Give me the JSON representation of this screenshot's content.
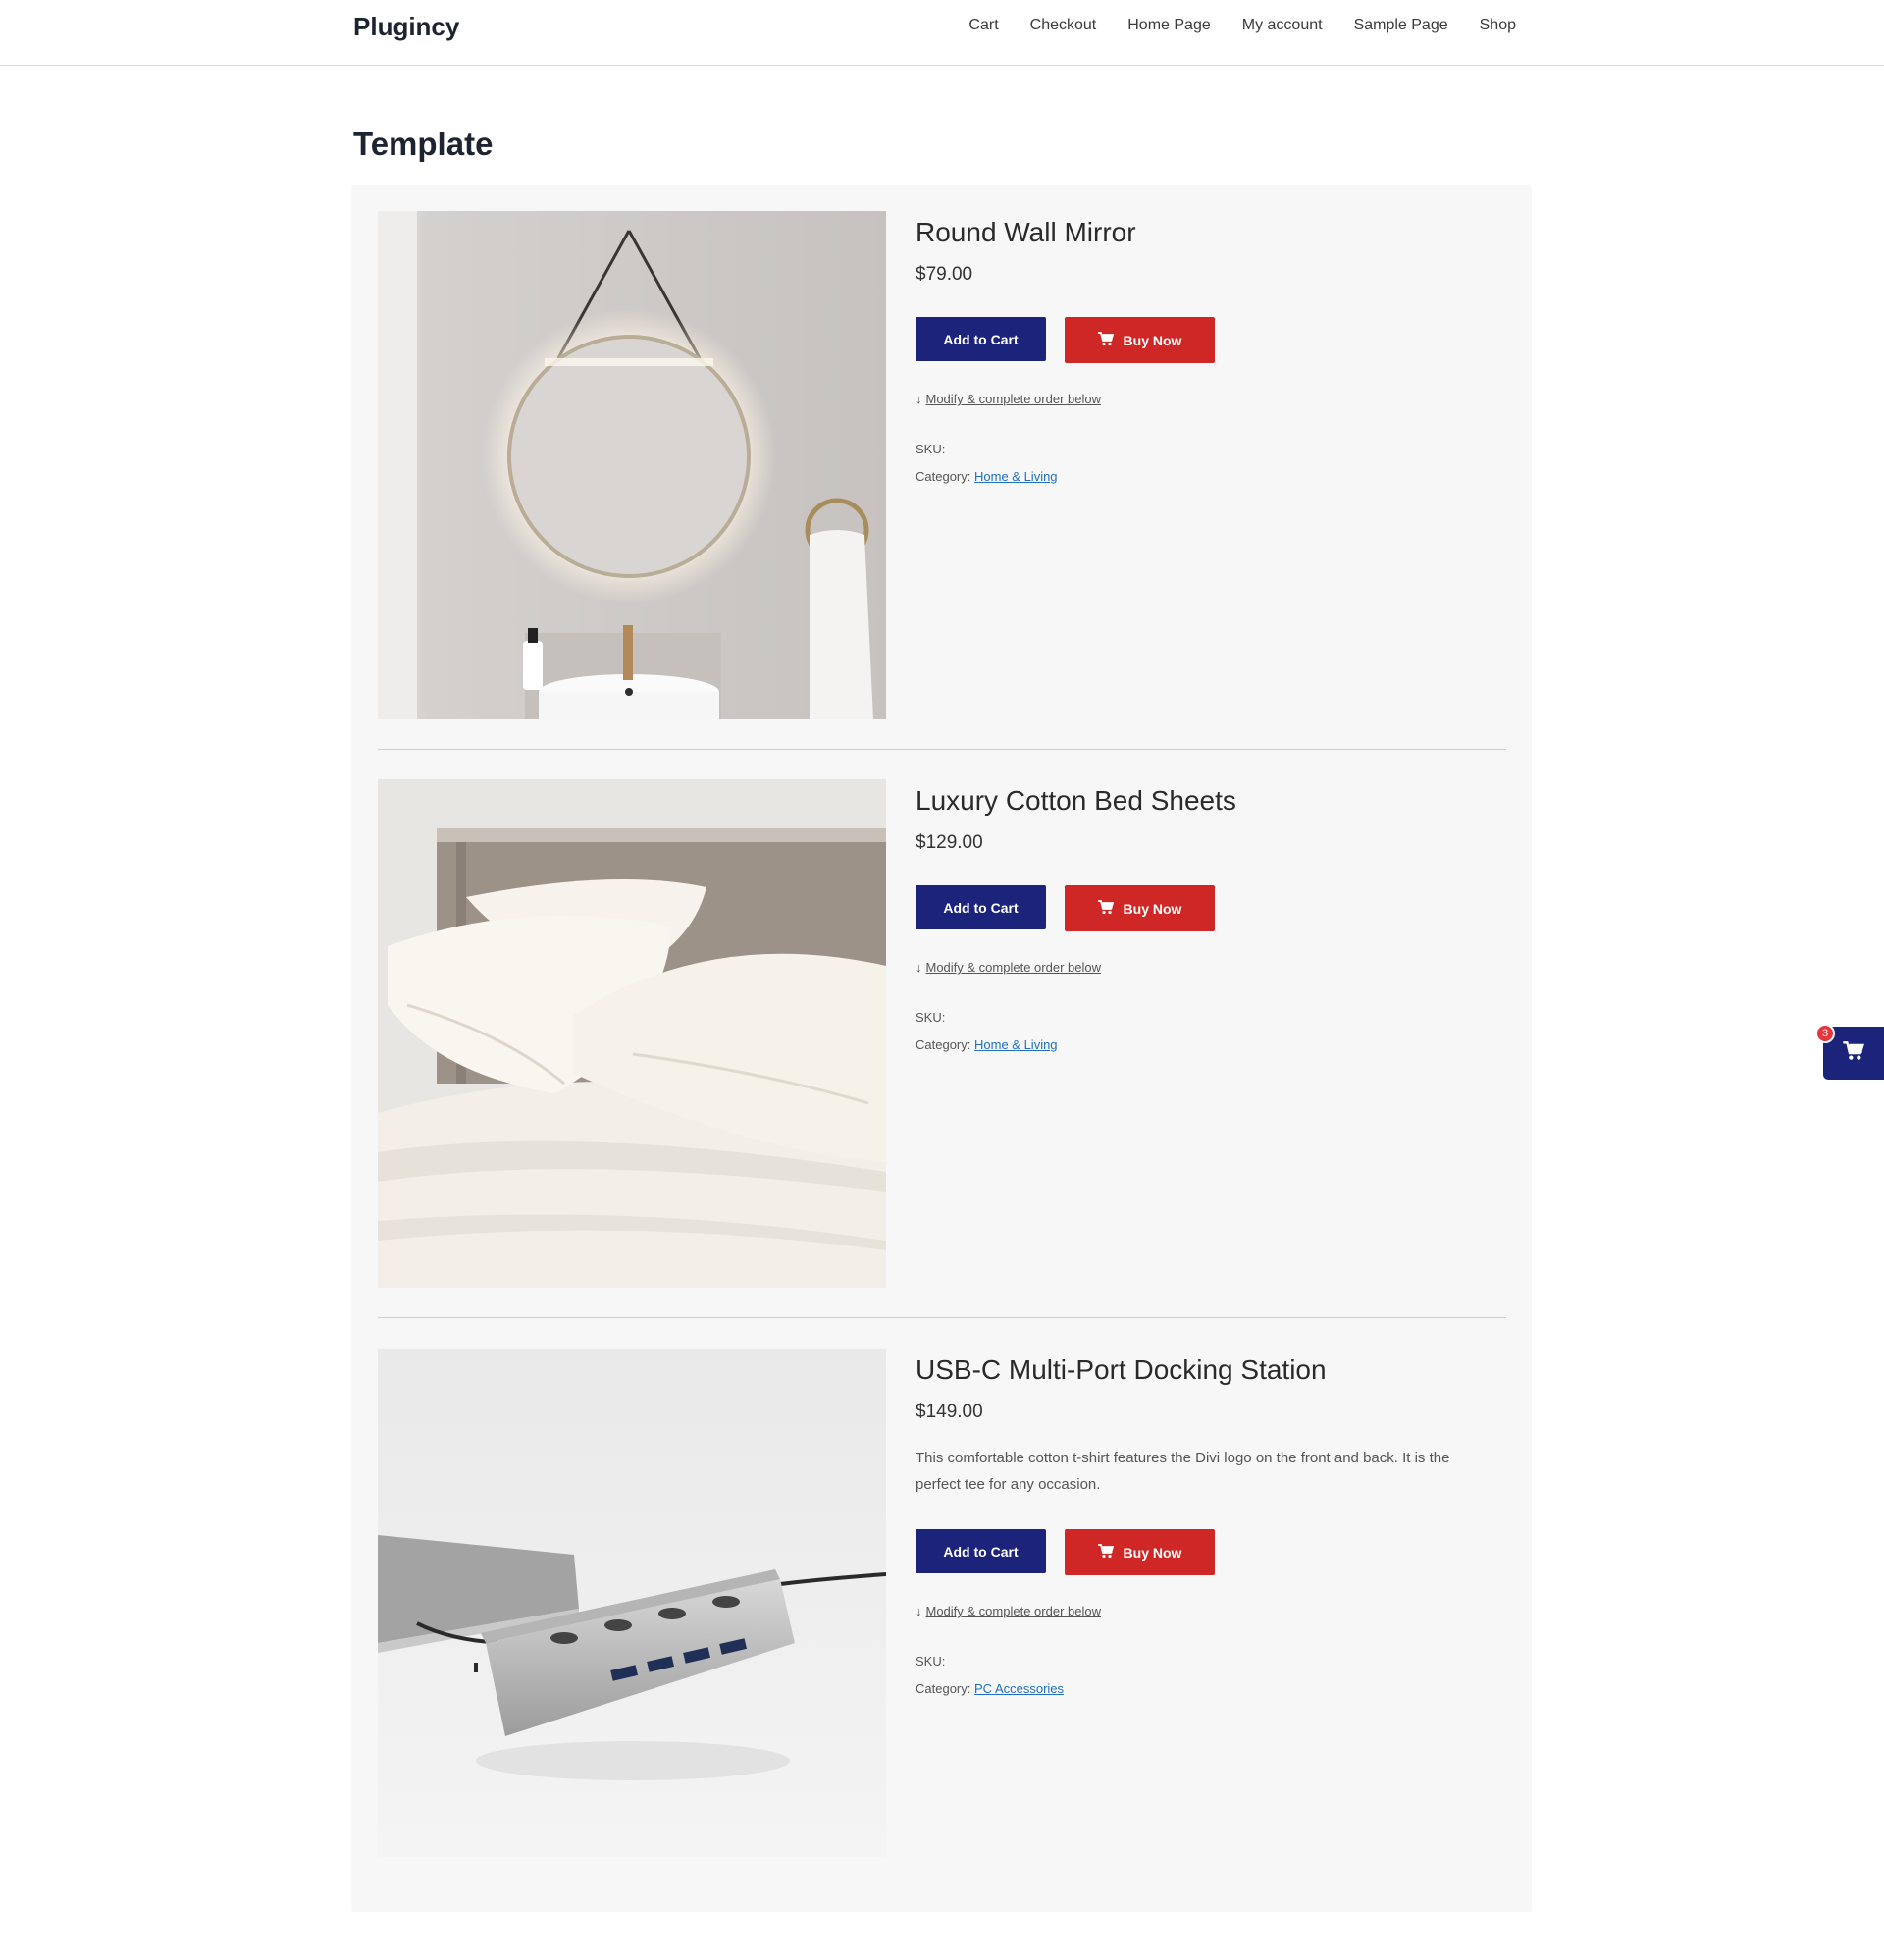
{
  "header": {
    "brand": "Plugincy",
    "nav": [
      "Cart",
      "Checkout",
      "Home Page",
      "My account",
      "Sample Page",
      "Shop"
    ]
  },
  "page": {
    "title": "Template"
  },
  "products": [
    {
      "title": "Round Wall Mirror",
      "price": "$79.00",
      "description": "",
      "add_to_cart": "Add to Cart",
      "buy_now": "Buy Now",
      "modify_arrow": "↓",
      "modify": "Modify & complete order below",
      "sku_label": "SKU:",
      "category_label": "Category:",
      "category": "Home & Living"
    },
    {
      "title": "Luxury Cotton Bed Sheets",
      "price": "$129.00",
      "description": "",
      "add_to_cart": "Add to Cart",
      "buy_now": "Buy Now",
      "modify_arrow": "↓",
      "modify": "Modify & complete order below",
      "sku_label": "SKU:",
      "category_label": "Category:",
      "category": "Home & Living"
    },
    {
      "title": "USB-C Multi-Port Docking Station",
      "price": "$149.00",
      "description": "This comfortable cotton t-shirt features the Divi logo on the front and back. It is the perfect tee for any occasion.",
      "add_to_cart": "Add to Cart",
      "buy_now": "Buy Now",
      "modify_arrow": "↓",
      "modify": "Modify & complete order below",
      "sku_label": "SKU:",
      "category_label": "Category:",
      "category": "PC Accessories"
    }
  ],
  "floating_cart": {
    "count": "3",
    "icon": "cart-icon"
  },
  "colors": {
    "primary": "#1b237a",
    "buy": "#cf2626",
    "link": "#1f6fc2",
    "badge": "#e8343a"
  }
}
